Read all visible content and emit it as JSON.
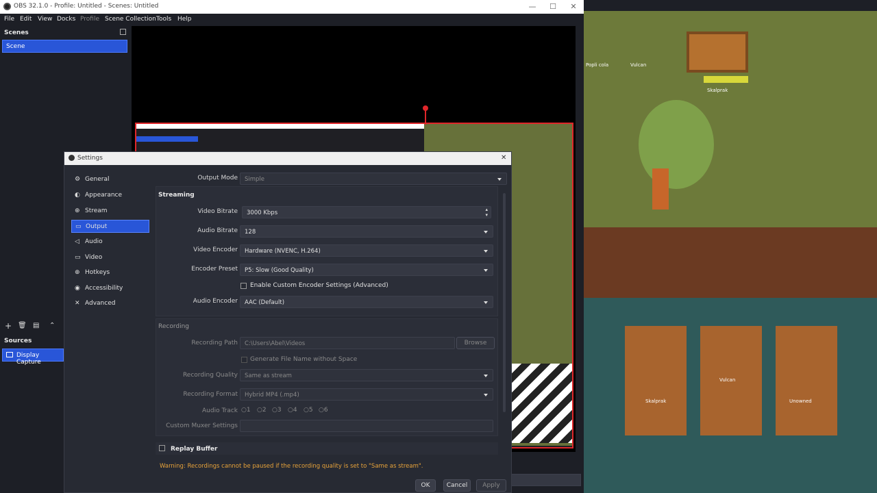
{
  "window": {
    "title": "OBS 32.1.0 - Profile: Untitled - Scenes: Untitled",
    "controls": [
      "—",
      "☐",
      "✕"
    ]
  },
  "menubar": [
    "File",
    "Edit",
    "View",
    "Docks",
    "Profile",
    "Scene Collection",
    "Tools",
    "Help"
  ],
  "scenes": {
    "header": "Scenes",
    "items": [
      "Scene"
    ]
  },
  "sources": {
    "header": "Sources",
    "items": [
      "Display Capture"
    ]
  },
  "settings": {
    "title": "Settings",
    "close": "✕",
    "nav": [
      {
        "icon": "⚙",
        "label": "General"
      },
      {
        "icon": "◐",
        "label": "Appearance"
      },
      {
        "icon": "⊕",
        "label": "Stream"
      },
      {
        "icon": "▭",
        "label": "Output"
      },
      {
        "icon": "◁",
        "label": "Audio"
      },
      {
        "icon": "▭",
        "label": "Video"
      },
      {
        "icon": "⊕",
        "label": "Hotkeys"
      },
      {
        "icon": "◉",
        "label": "Accessibility"
      },
      {
        "icon": "✕",
        "label": "Advanced"
      }
    ],
    "output_mode": {
      "label": "Output Mode",
      "value": "Simple"
    },
    "streaming": {
      "header": "Streaming",
      "video_bitrate": {
        "label": "Video Bitrate",
        "value": "3000 Kbps"
      },
      "audio_bitrate": {
        "label": "Audio Bitrate",
        "value": "128"
      },
      "video_encoder": {
        "label": "Video Encoder",
        "value": "Hardware (NVENC, H.264)"
      },
      "encoder_preset": {
        "label": "Encoder Preset",
        "value": "P5: Slow (Good Quality)"
      },
      "custom_encoder": "Enable Custom Encoder Settings (Advanced)",
      "audio_encoder": {
        "label": "Audio Encoder",
        "value": "AAC (Default)"
      }
    },
    "recording": {
      "header": "Recording",
      "path": {
        "label": "Recording Path",
        "value": "C:\\Users\\Abel\\Videos"
      },
      "browse": "Browse",
      "gen_filename": "Generate File Name without Space",
      "quality": {
        "label": "Recording Quality",
        "value": "Same as stream"
      },
      "format": {
        "label": "Recording Format",
        "value": "Hybrid MP4 (.mp4)"
      },
      "audio_track": {
        "label": "Audio Track",
        "tracks": [
          "1",
          "2",
          "3",
          "4",
          "5",
          "6"
        ]
      },
      "muxer": {
        "label": "Custom Muxer Settings",
        "value": ""
      }
    },
    "replay_buffer": "Replay Buffer",
    "warning": "Warning: Recordings cannot be paused if the recording quality is set to \"Same as stream\".",
    "buttons": {
      "ok": "OK",
      "cancel": "Cancel",
      "apply": "Apply"
    }
  },
  "game": {
    "labels": [
      "Popli cola",
      "Vulcan",
      "Skalprak",
      "Vulcan",
      "Skalprak",
      "Unowned"
    ]
  }
}
